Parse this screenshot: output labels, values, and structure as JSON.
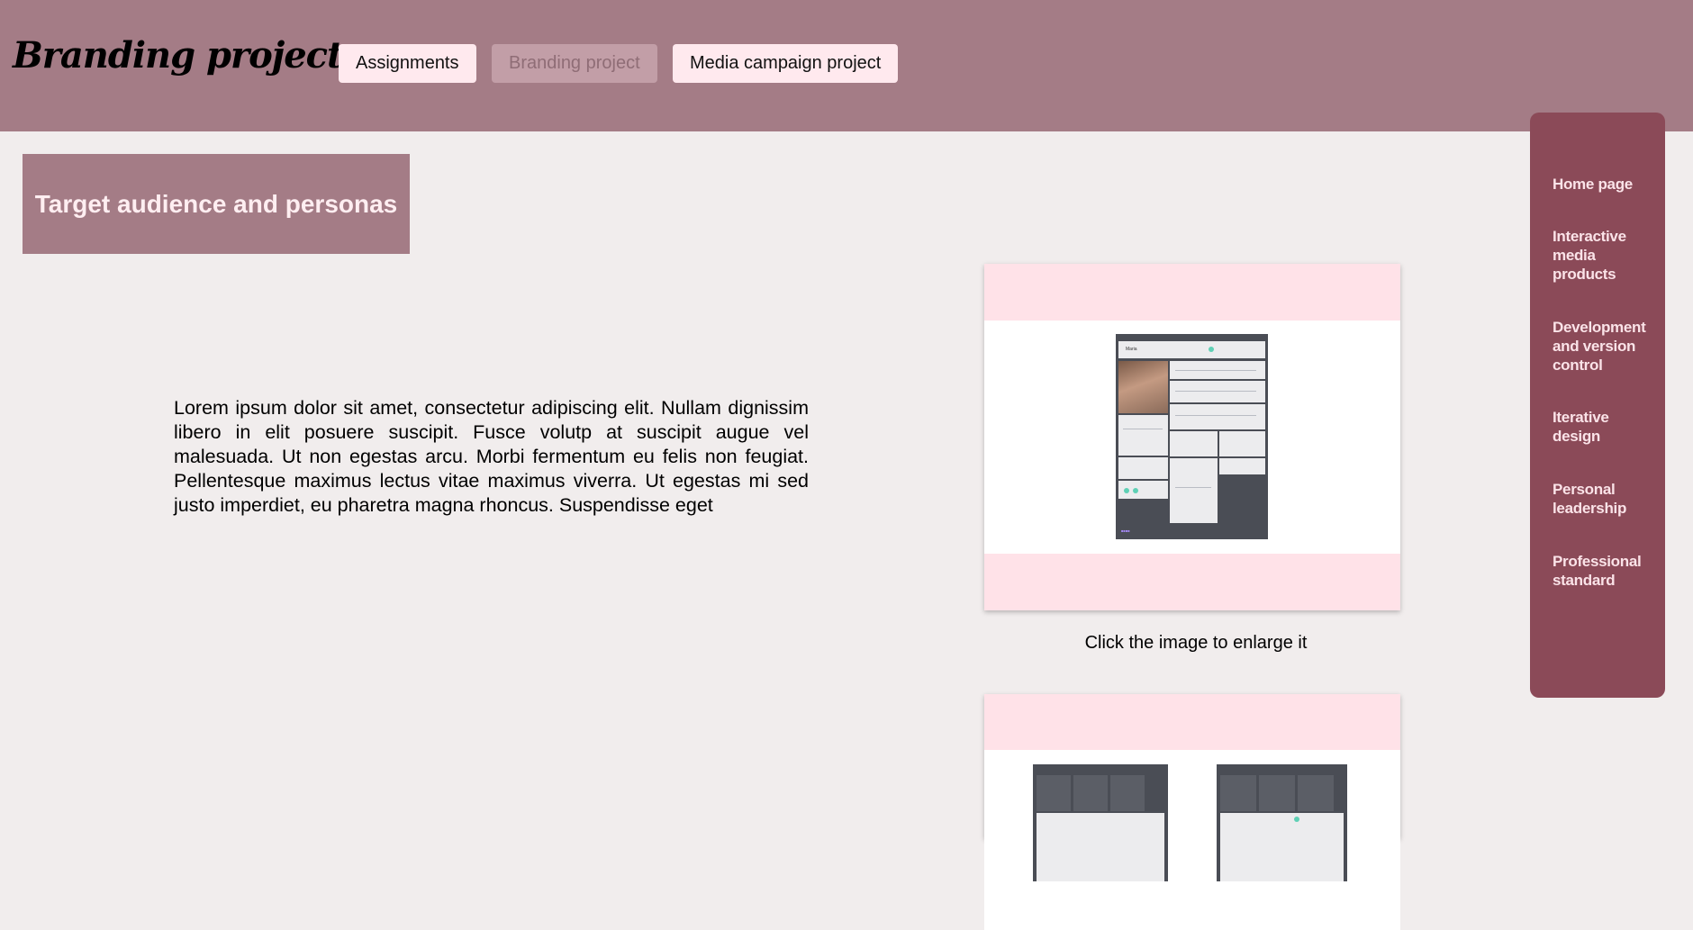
{
  "header": {
    "brand": "Branding project",
    "nav": [
      {
        "label": "Assignments",
        "active": false
      },
      {
        "label": "Branding project",
        "active": true
      },
      {
        "label": "Media campaign project",
        "active": false
      }
    ]
  },
  "main": {
    "section_title": "Target audience and personas",
    "paragraph": "Lorem ipsum dolor sit amet, consectetur adipiscing elit. Nullam dignissim libero in elit posuere suscipit. Fusce volutp at suscipit augue vel malesuada. Ut non egestas arcu. Morbi fermentum eu felis non feugiat. Pellentesque maximus lectus vitae maximus viverra. Ut egestas mi sed justo imperdiet, eu pharetra magna rhoncus. Suspendisse eget",
    "image_caption": "Click the image to enlarge it",
    "persona_name": "Maria"
  },
  "sidebar": {
    "items": [
      {
        "label": "Home page"
      },
      {
        "label": "Interactive media products"
      },
      {
        "label": "Development and version control"
      },
      {
        "label": "Iterative design"
      },
      {
        "label": "Personal leadership"
      },
      {
        "label": "Professional standard"
      }
    ]
  },
  "colors": {
    "header_bg": "#a47c86",
    "page_bg": "#f1eded",
    "nav_button_bg": "#ffe9ee",
    "nav_button_active_bg": "#c29ea7",
    "sidebar_bg": "#8b4a58",
    "card_bg": "#ffe2e8"
  }
}
